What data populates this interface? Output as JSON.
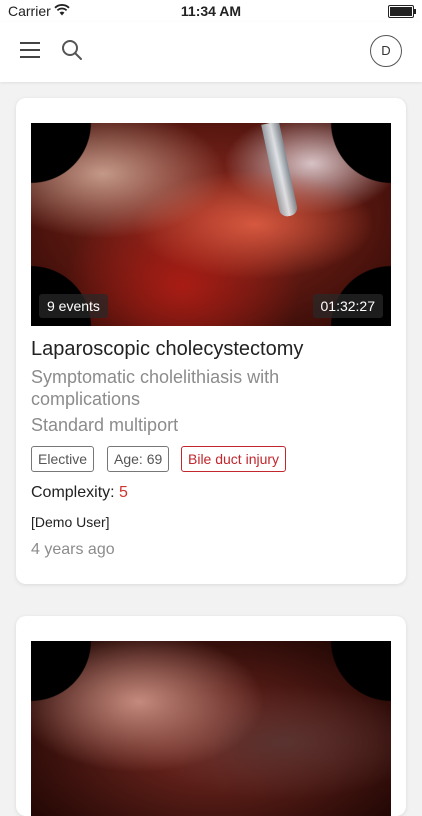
{
  "status_bar": {
    "carrier": "Carrier",
    "time": "11:34 AM"
  },
  "header": {
    "menu_icon": "hamburger-menu-icon",
    "search_icon": "search-icon",
    "avatar_initial": "D"
  },
  "cases": [
    {
      "events": "9 events",
      "duration": "01:32:27",
      "title": "Laparoscopic cholecystectomy",
      "diagnosis": "Symptomatic cholelithiasis with complications",
      "approach": "Standard multiport",
      "tags": [
        "Elective",
        "Age: 69",
        "Bile duct injury"
      ],
      "complexity_label": "Complexity:",
      "complexity_value": "5",
      "user": "[Demo User]",
      "age": "4 years ago"
    }
  ],
  "colors": {
    "alert_red": "#c1272d",
    "muted_gray": "#8c8c8c",
    "page_background": "#f2f2f2"
  }
}
